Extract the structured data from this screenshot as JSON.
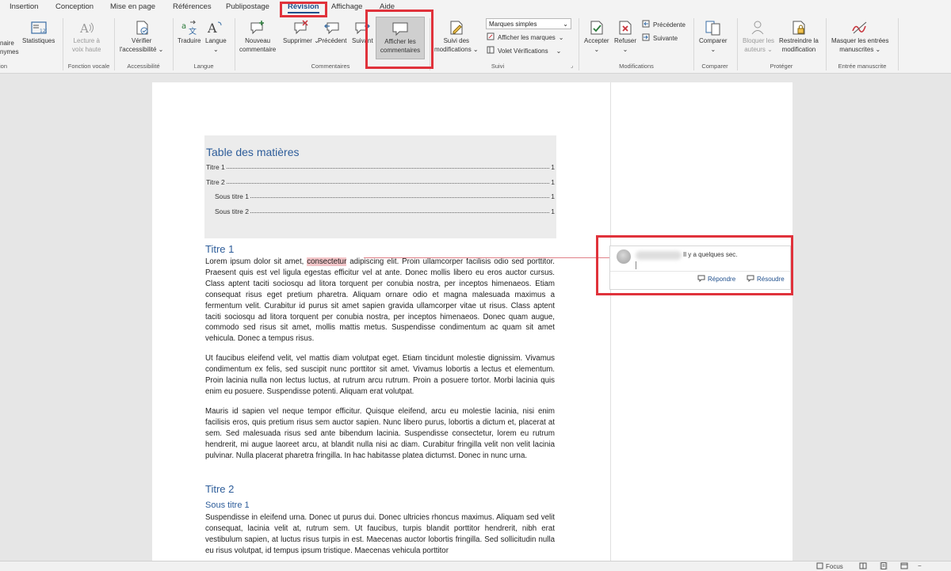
{
  "tabs": [
    "Insertion",
    "Conception",
    "Mise en page",
    "Références",
    "Publipostage",
    "Révision",
    "Affichage",
    "Aide"
  ],
  "active_tab": "Révision",
  "ribbon": {
    "partial_left": {
      "line1": "naire",
      "line2": "nymes",
      "group": "ion"
    },
    "statistiques": "Statistiques",
    "lecture": {
      "line1": "Lecture à",
      "line2": "voix haute"
    },
    "fonction_vocale": "Fonction vocale",
    "verifier": {
      "line1": "Vérifier",
      "line2": "l'accessibilité"
    },
    "accessibilite": "Accessibilité",
    "traduire": "Traduire",
    "langue_btn": "Langue",
    "langue_group": "Langue",
    "nouveau": {
      "line1": "Nouveau",
      "line2": "commentaire"
    },
    "supprimer": "Supprimer",
    "precedent": "Précédent",
    "suivant": "Suivant",
    "afficher": {
      "line1": "Afficher les",
      "line2": "commentaires"
    },
    "commentaires_group": "Commentaires",
    "suivi_modifs": {
      "line1": "Suivi des",
      "line2": "modifications"
    },
    "marques_select": "Marques simples",
    "afficher_marques": "Afficher les marques",
    "volet": "Volet Vérifications",
    "suivi_group": "Suivi",
    "accepter": "Accepter",
    "refuser": "Refuser",
    "precedente": "Précédente",
    "suivante": "Suivante",
    "modifications_group": "Modifications",
    "comparer_btn": "Comparer",
    "comparer_group": "Comparer",
    "bloquer": {
      "line1": "Bloquer les",
      "line2": "auteurs"
    },
    "restreindre": {
      "line1": "Restreindre la",
      "line2": "modification"
    },
    "proteger_group": "Protéger",
    "masquer": {
      "line1": "Masquer les entrées",
      "line2": "manuscrites"
    },
    "manuscrite_group": "Entrée manuscrite"
  },
  "toc": {
    "title": "Table des matières",
    "entries": [
      {
        "label": "Titre 1",
        "page": "1"
      },
      {
        "label": "Titre 2",
        "page": "1"
      },
      {
        "label": "Sous titre 1",
        "page": "1"
      },
      {
        "label": "Sous titre 2",
        "page": "1"
      }
    ]
  },
  "doc": {
    "titre1": "Titre 1",
    "p1_before": "Lorem ipsum dolor sit amet, ",
    "p1_highlight": "consectetur",
    "p1_after": " adipiscing elit. Proin ullamcorper facilisis odio sed porttitor. Praesent quis est vel ligula egestas efficitur vel at ante. Donec mollis libero eu eros auctor cursus. Class aptent taciti sociosqu ad litora torquent per conubia nostra, per inceptos himenaeos. Etiam consequat risus eget pretium pharetra. Aliquam ornare odio et magna malesuada maximus a fermentum velit. Curabitur id purus sit amet sapien gravida ullamcorper vitae ut risus. Class aptent taciti sociosqu ad litora torquent per conubia nostra, per inceptos himenaeos. Donec quam augue, commodo sed risus sit amet, mollis mattis metus. Suspendisse condimentum ac quam sit amet vehicula. Donec a tempus risus.",
    "p2": "Ut faucibus eleifend velit, vel mattis diam volutpat eget. Etiam tincidunt molestie dignissim. Vivamus condimentum ex felis, sed suscipit nunc porttitor sit amet. Vivamus lobortis a lectus et elementum. Proin lacinia nulla non lectus luctus, at rutrum arcu rutrum. Proin a posuere tortor. Morbi lacinia quis enim eu posuere. Suspendisse potenti. Aliquam erat volutpat.",
    "p3": "Mauris id sapien vel neque tempor efficitur. Quisque eleifend, arcu eu molestie lacinia, nisi enim facilisis eros, quis pretium risus sem auctor sapien. Nunc libero purus, lobortis a dictum et, placerat at sem. Sed malesuada risus sed ante bibendum lacinia. Suspendisse consectetur, lorem eu rutrum hendrerit, mi augue laoreet arcu, at blandit nulla nisi ac diam. Curabitur fringilla velit non velit lacinia pulvinar. Nulla placerat pharetra fringilla. In hac habitasse platea dictumst. Donec in nunc urna.",
    "titre2": "Titre 2",
    "sous_titre1": "Sous titre 1",
    "p4": "Suspendisse in eleifend urna. Donec ut purus dui. Donec ultricies rhoncus maximus. Aliquam sed velit consequat, lacinia velit at, rutrum sem. Ut faucibus, turpis blandit porttitor hendrerit, nibh erat vestibulum sapien, at luctus risus turpis in est. Maecenas auctor lobortis fringilla. Sed sollicitudin nulla eu risus volutpat, id tempus ipsum tristique. Maecenas vehicula porttitor"
  },
  "comment": {
    "time": "Il y a quelques sec.",
    "reply": "Répondre",
    "resolve": "Résoudre"
  },
  "statusbar": {
    "focus": "Focus"
  },
  "colors": {
    "accent": "#1e4e8c",
    "highlight_box": "#e0323b",
    "heading": "#2e5d9a"
  }
}
